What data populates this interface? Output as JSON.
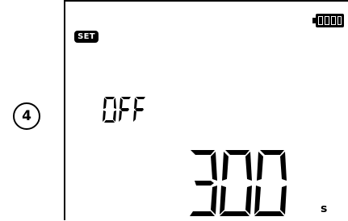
{
  "step": {
    "number": "4"
  },
  "screen": {
    "set_indicator": "SET",
    "battery_icon": "battery-full-icon",
    "mode_text": "OFF",
    "value": "300",
    "unit": "s"
  },
  "colors": {
    "segment": "#000000",
    "background": "#ffffff"
  }
}
